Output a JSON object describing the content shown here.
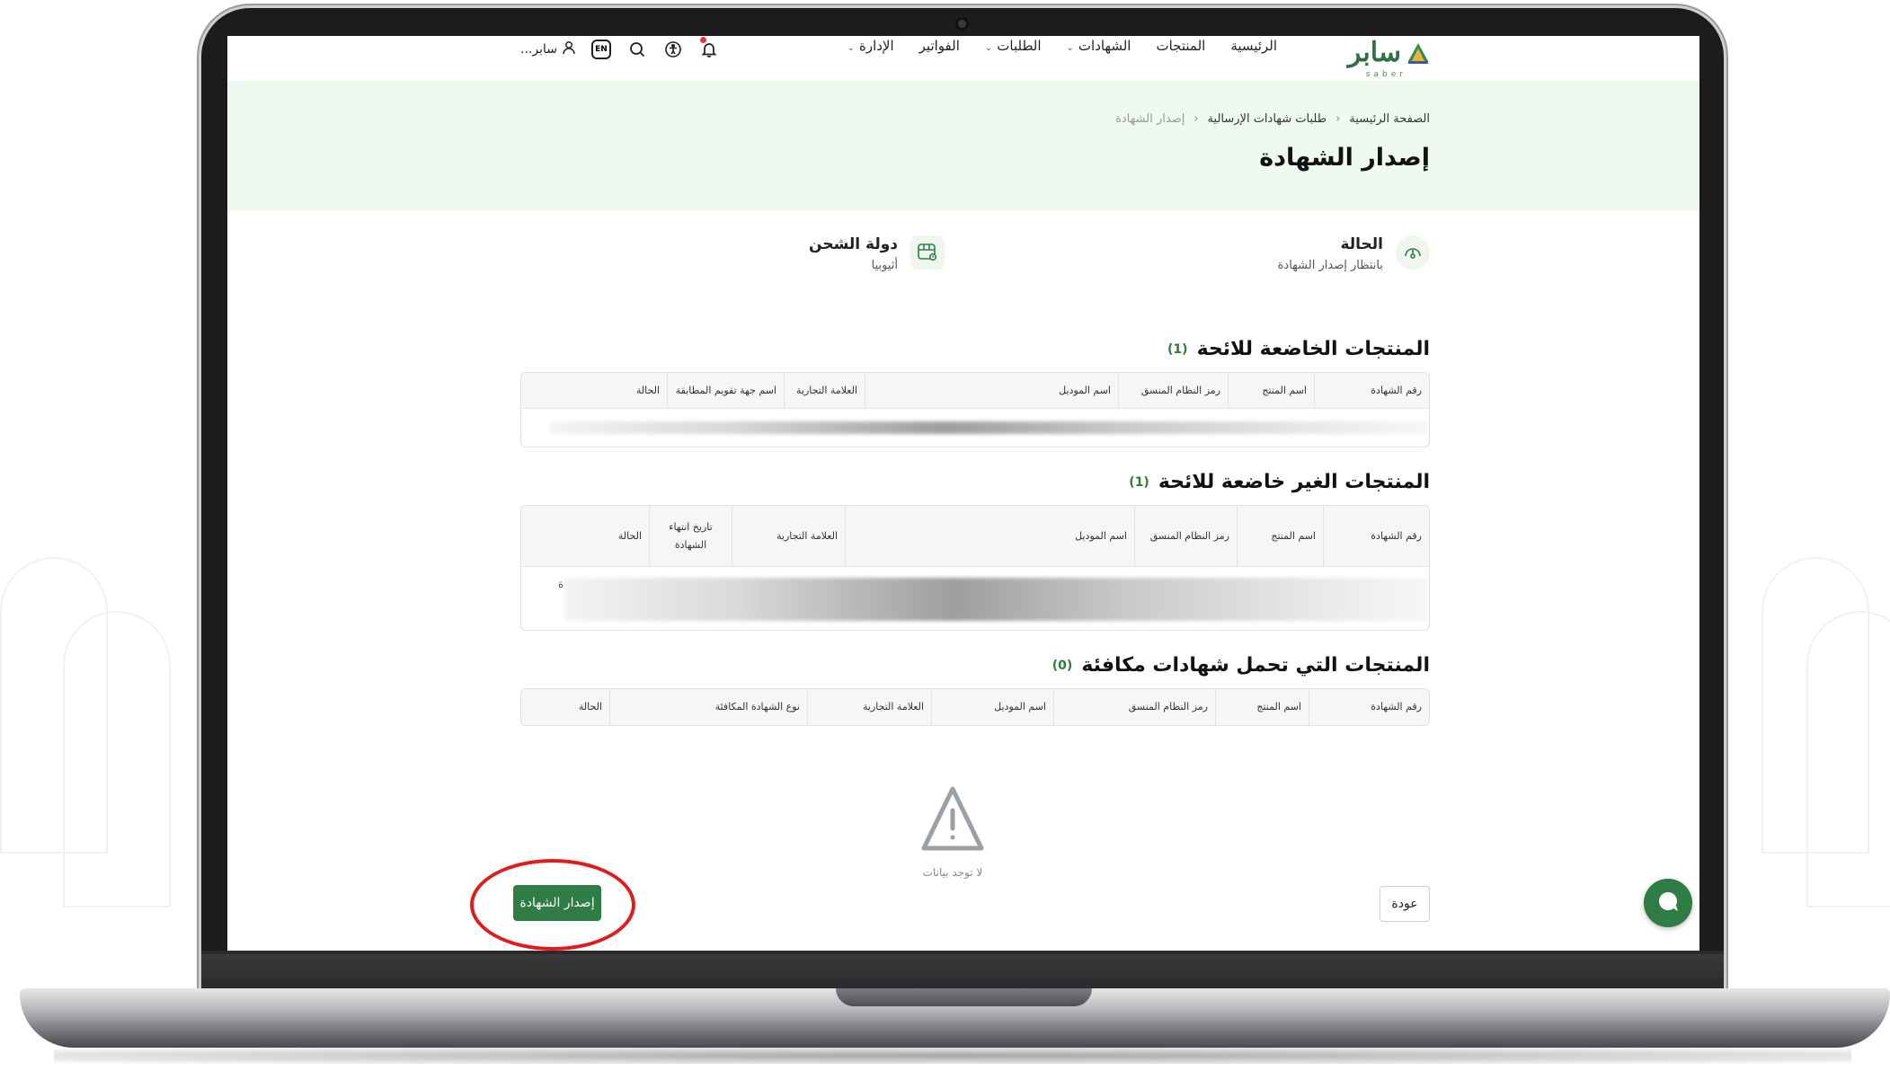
{
  "nav": {
    "logo_word": "سابر",
    "logo_sub": "saber",
    "links": [
      {
        "label": "الرئيسية",
        "has_caret": false
      },
      {
        "label": "المنتجات",
        "has_caret": false
      },
      {
        "label": "الشهادات",
        "has_caret": true
      },
      {
        "label": "الطلبات",
        "has_caret": true
      },
      {
        "label": "الفواتير",
        "has_caret": false
      },
      {
        "label": "الإدارة",
        "has_caret": true
      }
    ],
    "lang_badge": "EN",
    "user_name": "سابر..."
  },
  "breadcrumb": {
    "home": "الصفحة الرئيسية",
    "parent": "طلبات شهادات الإرسالية",
    "current": "إصدار الشهادة"
  },
  "page_title": "إصدار الشهادة",
  "status_card": {
    "title": "الحالة",
    "value": "بانتظار إصدار الشهادة"
  },
  "shipping_card": {
    "title": "دولة الشحن",
    "value": "أثيوبيا"
  },
  "sections": [
    {
      "title": "المنتجات الخاضعة للائحة",
      "count": "(1)",
      "columns": [
        "رقم الشهادة",
        "اسم المنتج",
        "رمز النظام المنسق",
        "اسم الموديل",
        "العلامة التجارية",
        "اسم جهة تقويم المطابقة",
        "الحالة"
      ]
    },
    {
      "title": "المنتجات الغير خاضعة للائحة",
      "count": "(1)",
      "columns": [
        "رقم الشهادة",
        "اسم المنتج",
        "رمز النظام المنسق",
        "اسم الموديل",
        "العلامة التجارية",
        "تاريخ انتهاء الشهادة",
        "الحالة"
      ],
      "row_stray_char": "ة"
    },
    {
      "title": "المنتجات التي تحمل شهادات مكافئة",
      "count": "(0)",
      "columns": [
        "رقم الشهادة",
        "اسم المنتج",
        "رمز النظام المنسق",
        "اسم الموديل",
        "العلامة التجارية",
        "نوع الشهادة المكافئة",
        "الحالة"
      ]
    }
  ],
  "empty_state": {
    "text": "لا توجد بيانات"
  },
  "buttons": {
    "issue": "إصدار الشهادة",
    "back": "عودة"
  },
  "colors": {
    "brand_green": "#2f7d45",
    "header_band": "#eef9ef",
    "highlight": "#e01b1b",
    "notification": "#e53935"
  }
}
